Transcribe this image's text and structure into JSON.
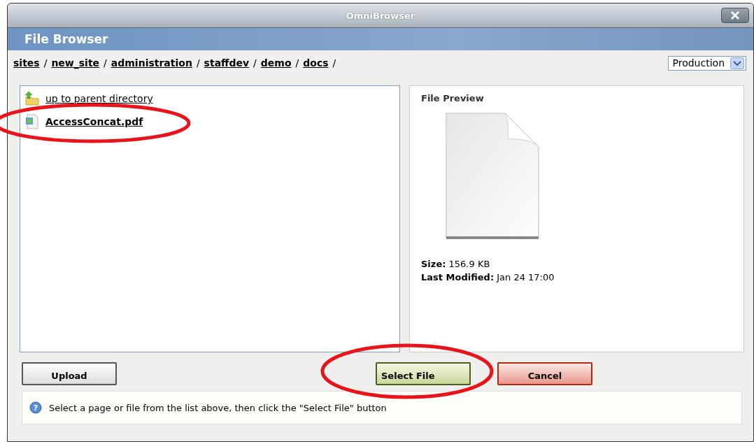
{
  "window": {
    "title": "OmniBrowser"
  },
  "header": {
    "title": "File Browser"
  },
  "breadcrumb": [
    {
      "label": "sites",
      "separator": "/"
    },
    {
      "label": "new_site",
      "separator": "/"
    },
    {
      "label": "administration",
      "separator": "/"
    },
    {
      "label": "staffdev",
      "separator": "/"
    },
    {
      "label": "demo",
      "separator": "/"
    },
    {
      "label": "docs",
      "separator": "/"
    }
  ],
  "environment": {
    "value": "Production"
  },
  "files": [
    {
      "kind": "parent",
      "label": "up to parent directory"
    },
    {
      "kind": "file",
      "label": "AccessConcat.pdf"
    }
  ],
  "preview": {
    "title": "File Preview",
    "size_label": "Size:",
    "size": "156.9 KB",
    "modified_label": "Last Modified:",
    "modified": "Jan 24 17:00"
  },
  "buttons": [
    {
      "kind": "plain",
      "label": "Upload"
    },
    {
      "kind": "select",
      "label": "Select File"
    },
    {
      "kind": "cancel",
      "label": "Cancel"
    }
  ],
  "hint_icon": "?",
  "hint": "Select a page or file from the list above, then click the \"Select File\" button"
}
